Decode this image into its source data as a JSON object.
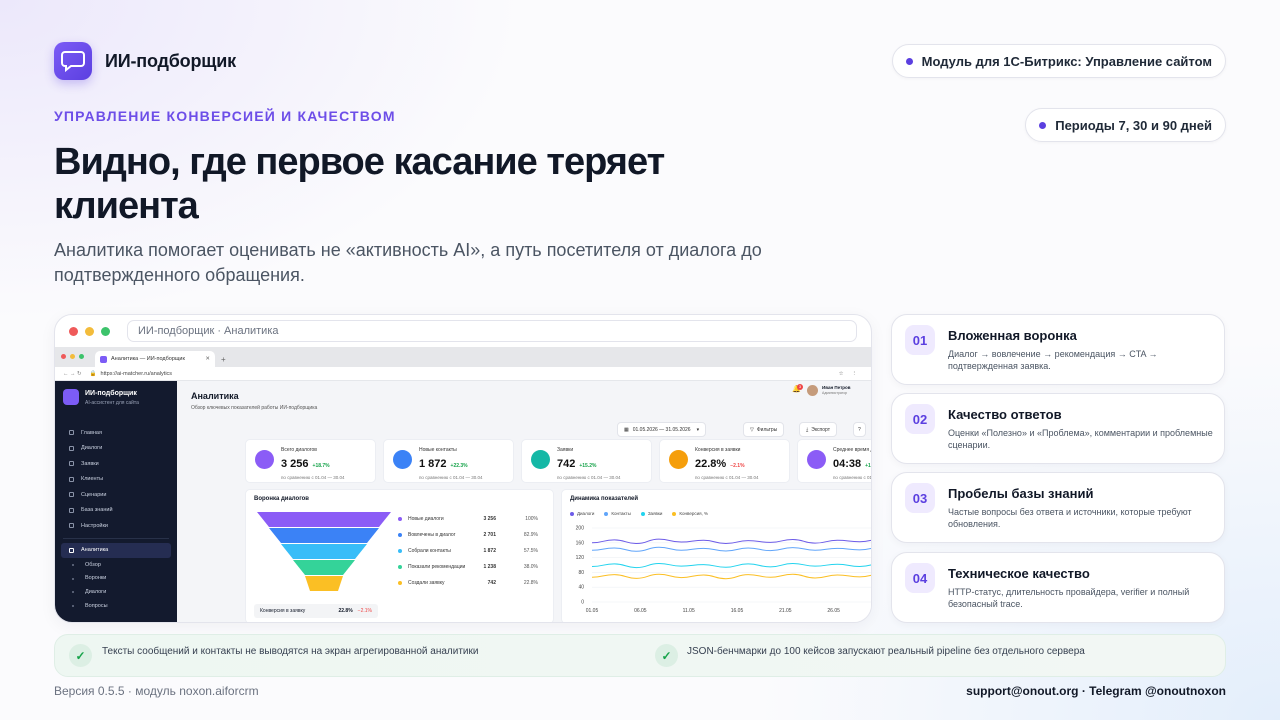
{
  "brand": {
    "name": "ИИ-подборщик",
    "logo_icon": "chat-bubble-icon"
  },
  "pills": [
    "Модуль для 1С-Битрикс: Управление сайтом",
    "Периоды 7, 30 и 90 дней"
  ],
  "hero": {
    "eyebrow": "УПРАВЛЕНИЕ КОНВЕРСИЕЙ И КАЧЕСТВОМ",
    "title": "Видно, где первое касание теряет клиента",
    "lead": "Аналитика помогает оценивать не «активность AI», а путь посетителя от диалога до подтвержденного обращения."
  },
  "browser": {
    "url_label": "ИИ-подборщик · Аналитика",
    "inner_tab": "Аналитика — ИИ-подборщик",
    "inner_url": "https://ai-matcher.ru/analytics"
  },
  "app": {
    "sidebar_title": "ИИ-подборщик",
    "sidebar_subtitle": "AI-ассистент для сайта",
    "nav": [
      "Главная",
      "Диалоги",
      "Заявки",
      "Клиенты",
      "Сценарии",
      "База знаний",
      "Настройки",
      "Аналитика"
    ],
    "subnav": [
      "Обзор",
      "Воронки",
      "Диалоги",
      "Вопросы"
    ],
    "page_title": "Аналитика",
    "page_subtitle": "Обзор ключевых показателей работы ИИ-подборщика",
    "date_range": "01.05.2026 — 31.05.2026",
    "filters_label": "Фильтры",
    "export_label": "Экспорт",
    "help_label": "?",
    "notif_count": "3",
    "user_name": "Иван Петров",
    "user_role": "Администратор",
    "kpis": [
      {
        "label": "Всего диалогов",
        "value": "3 256",
        "delta": "+18.7%",
        "compare": "по сравнению с 01.04 — 30.04",
        "color": "#8b5cf6",
        "icon": "chat-icon"
      },
      {
        "label": "Новые контакты",
        "value": "1 872",
        "delta": "+22.3%",
        "compare": "по сравнению с 01.04 — 30.04",
        "color": "#3b82f6",
        "icon": "user-icon"
      },
      {
        "label": "Заявки",
        "value": "742",
        "delta": "+15.2%",
        "compare": "по сравнению с 01.04 — 30.04",
        "color": "#14b8a6",
        "icon": "document-icon"
      },
      {
        "label": "Конверсия в заявки",
        "value": "22.8%",
        "delta": "−2.1%",
        "compare": "по сравнению с 01.04 — 30.04",
        "color": "#f59e0b",
        "icon": "trophy-icon"
      },
      {
        "label": "Среднее время диалога",
        "value": "04:38",
        "delta": "+12.4%",
        "compare": "по сравнению с 01.04 — 30.04",
        "color": "#8b5cf6",
        "icon": "clock-icon"
      }
    ],
    "funnel": {
      "title": "Воронка диалогов",
      "rows": [
        {
          "label": "Новые диалоги",
          "value": "3 256",
          "pct": "100%",
          "color": "#8b5cf6"
        },
        {
          "label": "Вовлечены в диалог",
          "value": "2 701",
          "pct": "82.9%",
          "color": "#3b82f6"
        },
        {
          "label": "Собрали контакты",
          "value": "1 872",
          "pct": "57.5%",
          "color": "#38bdf8"
        },
        {
          "label": "Показали рекомендации",
          "value": "1 238",
          "pct": "38.0%",
          "color": "#34d399"
        },
        {
          "label": "Создали заявку",
          "value": "742",
          "pct": "22.8%",
          "color": "#fbbf24"
        }
      ],
      "conv_label": "Конверсия в заявку",
      "conv_value": "22.8%",
      "conv_delta": "−2.1%"
    },
    "chart_data": {
      "type": "line",
      "title": "Динамика показателей",
      "legend": [
        {
          "name": "Диалоги",
          "color": "#6d5ce8"
        },
        {
          "name": "Контакты",
          "color": "#60a5fa"
        },
        {
          "name": "Заявки",
          "color": "#22d3ee"
        },
        {
          "name": "Конверсия, %",
          "color": "#fbbf24"
        }
      ],
      "y_ticks": [
        "200",
        "160",
        "120",
        "80",
        "40",
        "0"
      ],
      "y2_ticks": [
        "50%",
        "40%",
        "30%",
        "20%",
        "10%",
        "0%"
      ],
      "x_ticks": [
        "01.05",
        "06.05",
        "11.05",
        "16.05",
        "21.05",
        "26.05",
        "31.05"
      ],
      "ylim": [
        0,
        200
      ],
      "series": [
        {
          "name": "Диалоги",
          "values": [
            160,
            168,
            158,
            170,
            162,
            167,
            158,
            166,
            161,
            169,
            159,
            167,
            163,
            170
          ]
        },
        {
          "name": "Контакты",
          "values": [
            140,
            146,
            137,
            148,
            140,
            145,
            138,
            146,
            139,
            147,
            140,
            145,
            141,
            148
          ]
        },
        {
          "name": "Заявки",
          "values": [
            96,
            103,
            93,
            104,
            97,
            101,
            94,
            103,
            95,
            104,
            97,
            102,
            96,
            104
          ]
        },
        {
          "name": "Конверсия, %",
          "values": [
            67,
            74,
            64,
            75,
            66,
            73,
            63,
            74,
            67,
            75,
            65,
            73,
            68,
            76
          ]
        }
      ]
    }
  },
  "features": [
    {
      "num": "01",
      "title": "Вложенная воронка",
      "desc": "Диалог → вовлечение → рекомендация → CTA → подтвержденная заявка."
    },
    {
      "num": "02",
      "title": "Качество ответов",
      "desc": "Оценки «Полезно» и «Проблема», комментарии и проблемные сценарии."
    },
    {
      "num": "03",
      "title": "Пробелы базы знаний",
      "desc": "Частые вопросы без ответа и источники, которые требуют обновления."
    },
    {
      "num": "04",
      "title": "Техническое качество",
      "desc": "HTTP-статус, длительность провайдера, verifier и полный безопасный trace."
    }
  ],
  "notes": [
    "Тексты сообщений и контакты не выводятся на экран агрегированной аналитики",
    "JSON-бенчмарки до 100 кейсов запускают реальный pipeline без отдельного сервера"
  ],
  "footer": {
    "left": "Версия 0.5.5 · модуль noxon.aiforcrm",
    "right": "support@onout.org · Telegram @onoutnoxon"
  }
}
